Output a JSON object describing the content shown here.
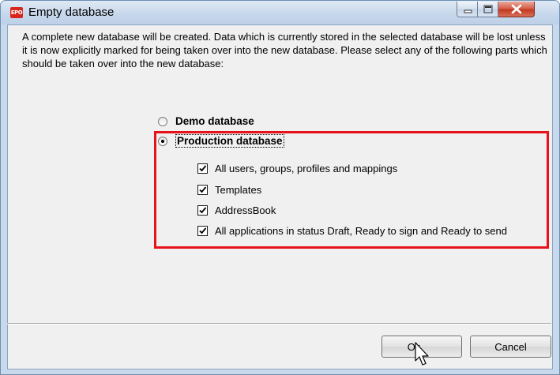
{
  "window": {
    "title": "Empty database",
    "logo_text": "EPO"
  },
  "description": "A complete new database will be created. Data which is currently stored in the selected database will be lost unless it is now explicitly marked for being taken over into the new database. Please select any of the following parts which should be taken over into the new database:",
  "options": {
    "demo_label": "Demo database",
    "demo_selected": false,
    "production_label": "Production database",
    "production_selected": true
  },
  "checkboxes": [
    {
      "label": "All users, groups, profiles and mappings",
      "checked": true
    },
    {
      "label": "Templates",
      "checked": true
    },
    {
      "label": "AddressBook",
      "checked": true
    },
    {
      "label": "All applications in status Draft, Ready to sign and Ready to send",
      "checked": true
    }
  ],
  "buttons": {
    "ok_label": "Ok",
    "cancel_label": "Cancel"
  },
  "colors": {
    "highlight": "#e8131a",
    "logo": "#d7261e"
  },
  "icons": {
    "minimize": "minimize-icon",
    "maximize": "maximize-icon",
    "close": "close-icon",
    "cursor": "mouse-pointer-icon"
  }
}
